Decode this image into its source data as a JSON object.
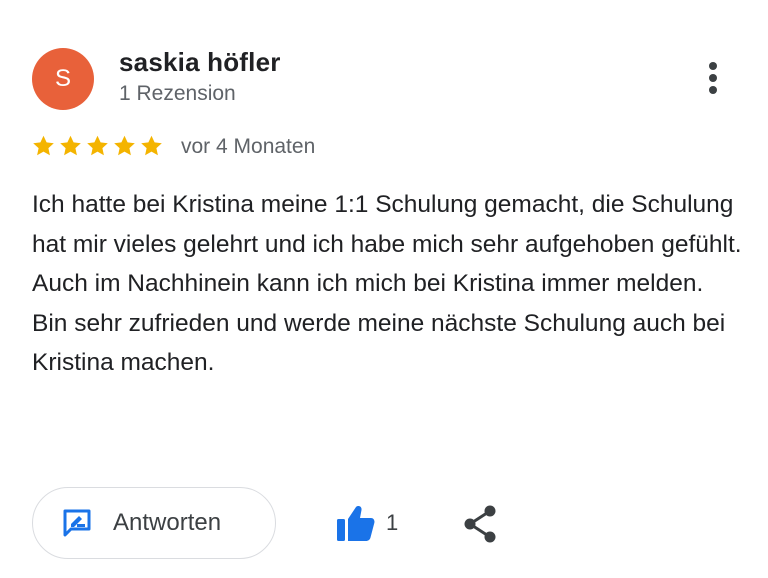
{
  "review": {
    "avatar_initial": "S",
    "avatar_color": "#e8613a",
    "author": "saskia höfler",
    "review_count": "1 Rezension",
    "rating": 5,
    "max_rating": 5,
    "star_color": "#f4b400",
    "time": "vor 4 Monaten",
    "text_lines": [
      "Ich hatte bei Kristina meine 1:1 Schulung gemacht, die Schulung hat mir vieles gelehrt und ich habe mich sehr aufgehoben gefühlt.",
      "Auch im Nachhinein kann ich mich bei Kristina immer melden.",
      "Bin sehr zufrieden und werde meine nächste Schulung auch bei Kristina machen."
    ]
  },
  "actions": {
    "reply_label": "Antworten",
    "like_count": "1",
    "accent_color": "#1a73e8",
    "icons": {
      "reply": "edit-comment-icon",
      "like": "thumbs-up-icon",
      "share": "share-icon",
      "more": "more-vert-icon",
      "star": "star-icon"
    }
  }
}
